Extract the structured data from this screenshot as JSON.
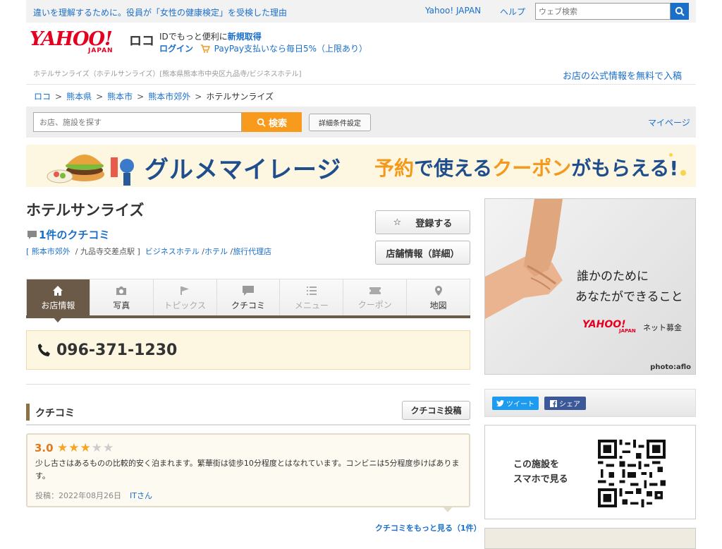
{
  "topbar": {
    "promo": "違いを理解するために。役員が「女性の健康検定」を受検した理由",
    "yahoo_japan": "Yahoo! JAPAN",
    "help": "ヘルプ",
    "search_placeholder": "ウェブ検索"
  },
  "logo": {
    "yahoo": "YAHOO!",
    "japan": "JAPAN",
    "loco": "ロコ"
  },
  "account": {
    "id_prefix": "IDでもっと便利に",
    "signup": "新規取得",
    "login": "ログイン",
    "paypay": "PayPay支払いなら毎日5%（上限あり）"
  },
  "meta_line": "ホテルサンライズ（ホテルサンライズ）[熊本県熊本市中央区九品寺/ビジネスホテル]",
  "free_info_link": "お店の公式情報を無料で入稿",
  "breadcrumb": {
    "items": [
      "ロコ",
      "熊本県",
      "熊本市",
      "熊本市郊外"
    ],
    "current": "ホテルサンライズ",
    "separator": ">"
  },
  "searchbar": {
    "placeholder": "お店、施設を探す",
    "button": "検索",
    "advanced": "詳細条件設定",
    "mypage": "マイページ"
  },
  "banner": {
    "title": "グルメマイレージ",
    "part1": "予約",
    "part2": "で使える",
    "part3": "クーポン",
    "part4": "がもらえる!"
  },
  "hotel": {
    "name": "ホテルサンライズ",
    "review_count_link": "1件のクチコミ",
    "area": "熊本市郊外",
    "station": "九品寺交差点駅",
    "categories": [
      "ビジネスホテル",
      "ホテル",
      "旅行代理店"
    ],
    "phone": "096-371-1230"
  },
  "actions": {
    "register": "登録する",
    "store_info": "店舗情報（詳細）"
  },
  "tabs": [
    {
      "label": "お店情報",
      "icon": "home-icon",
      "state": "active"
    },
    {
      "label": "写真",
      "icon": "camera-icon",
      "state": "enabled"
    },
    {
      "label": "トピックス",
      "icon": "flag-icon",
      "state": "disabled"
    },
    {
      "label": "クチコミ",
      "icon": "comment-icon",
      "state": "enabled"
    },
    {
      "label": "メニュー",
      "icon": "list-icon",
      "state": "disabled"
    },
    {
      "label": "クーポン",
      "icon": "ticket-icon",
      "state": "disabled"
    },
    {
      "label": "地図",
      "icon": "map-pin-icon",
      "state": "enabled"
    }
  ],
  "reviews": {
    "heading": "クチコミ",
    "post_button": "クチコミ投稿",
    "items": [
      {
        "score": "3.0",
        "stars": 3,
        "text": "少し古さはあるものの比較的安く泊まれます。繁華街は徒歩10分程度とはなれています。コンビニは5分程度歩けばあります。",
        "posted_label": "投稿：2022年08月26日",
        "author": "ITさん"
      }
    ],
    "more_link": "クチコミをもっと見る（1件）"
  },
  "ad": {
    "line1": "誰かのためにあ",
    "line1b": "誰かのために",
    "line2": "あなたができること",
    "brand": "YAHOO!",
    "brand_sub": "JAPAN",
    "service": "ネット募金",
    "credit": "photo:aflo"
  },
  "social": {
    "tweet": "ツイート",
    "share": "シェア"
  },
  "qr": {
    "label_line1": "この施設を",
    "label_line2": "スマホで見る"
  },
  "colors": {
    "accent": "#1a6fc9",
    "brand": "#e30020",
    "search_orange": "#f89b1c",
    "tab_active": "#6b5a47",
    "star": "#f5a623",
    "score": "#e3781c"
  }
}
